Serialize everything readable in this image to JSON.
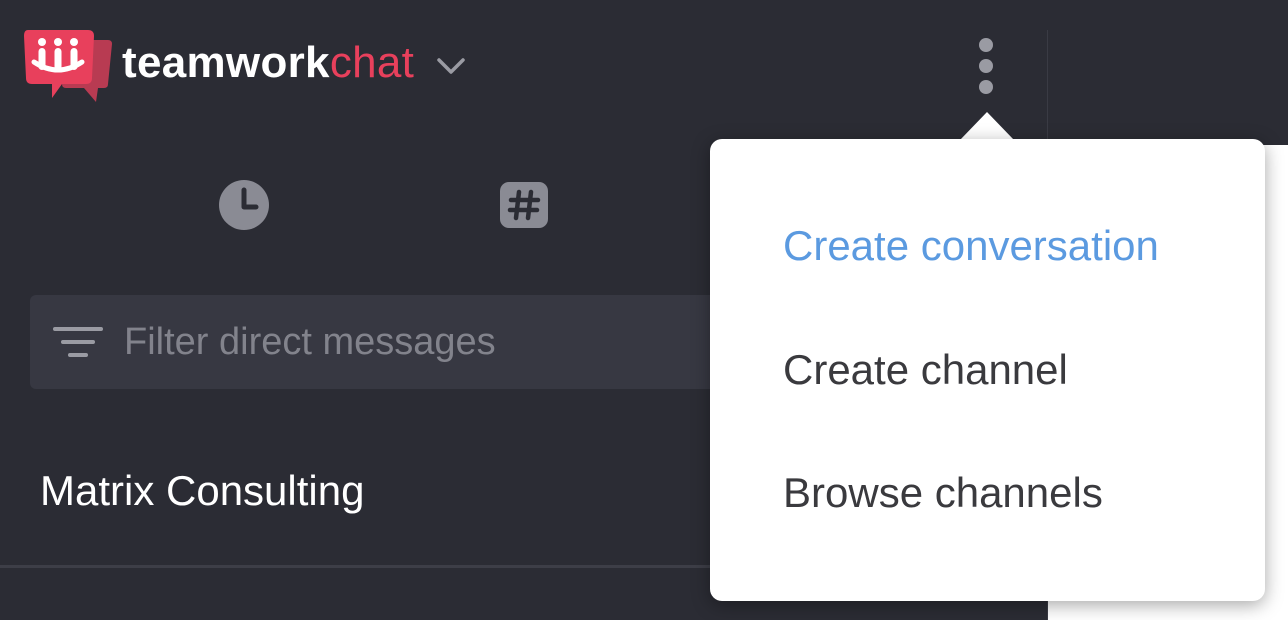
{
  "app": {
    "brand_primary": "teamwork",
    "brand_secondary": "chat",
    "brand_primary_color": "#ffffff",
    "brand_secondary_color": "#e8405c",
    "logo_icon": "teamwork-chat-logo-icon",
    "dropdown_icon": "chevron-down-icon",
    "more_icon": "kebab-vertical-icon"
  },
  "tabs": [
    {
      "name": "recent",
      "icon": "clock-icon"
    },
    {
      "name": "channels",
      "icon": "hash-icon"
    }
  ],
  "filter": {
    "placeholder": "Filter direct messages",
    "value": "",
    "icon": "filter-lines-icon"
  },
  "org": {
    "name": "Matrix Consulting"
  },
  "menu": {
    "items": [
      {
        "label": "Create conversation",
        "active": true
      },
      {
        "label": "Create channel",
        "active": false
      },
      {
        "label": "Browse channels",
        "active": false
      }
    ]
  },
  "colors": {
    "sidebar_bg": "#2b2c34",
    "input_bg": "#373842",
    "accent_blue": "#5b9ae0",
    "brand_red": "#e8405c"
  }
}
